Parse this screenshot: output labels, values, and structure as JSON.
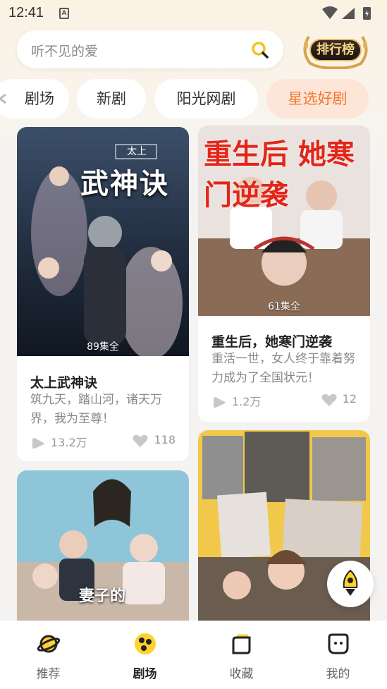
{
  "status_bar": {
    "time": "12:41",
    "a_badge": "A"
  },
  "search": {
    "placeholder": "听不见的爱"
  },
  "ranking": {
    "label": "排行榜"
  },
  "tabs": [
    {
      "label": "剧场"
    },
    {
      "label": "新剧"
    },
    {
      "label": "阳光网剧"
    },
    {
      "label": "星选好剧",
      "active": true
    }
  ],
  "cards": [
    {
      "title": "太上武神诀",
      "episodes": "89集全",
      "description": "筑九天，踏山河，诸天万界，我为至尊！",
      "plays": "13.2万",
      "likes": "118",
      "poster_text": "太上",
      "poster_title": "武神诀"
    },
    {
      "title": "重生后，她寒门逆袭",
      "episodes": "61集全",
      "description": "重活一世，女人终于靠着努力成为了全国状元！",
      "plays": "1.2万",
      "likes": "12",
      "poster_title": "重生后 她寒门逆袭"
    },
    {
      "title": "",
      "poster_text": "妻子的"
    },
    {
      "title": ""
    }
  ],
  "nav": [
    {
      "label": "推荐"
    },
    {
      "label": "剧场",
      "active": true
    },
    {
      "label": "收藏"
    },
    {
      "label": "我的"
    }
  ],
  "colors": {
    "accent": "#f5742c",
    "active_tab_bg": "#fde6d8",
    "nav_icon_yellow": "#ffd22e"
  }
}
